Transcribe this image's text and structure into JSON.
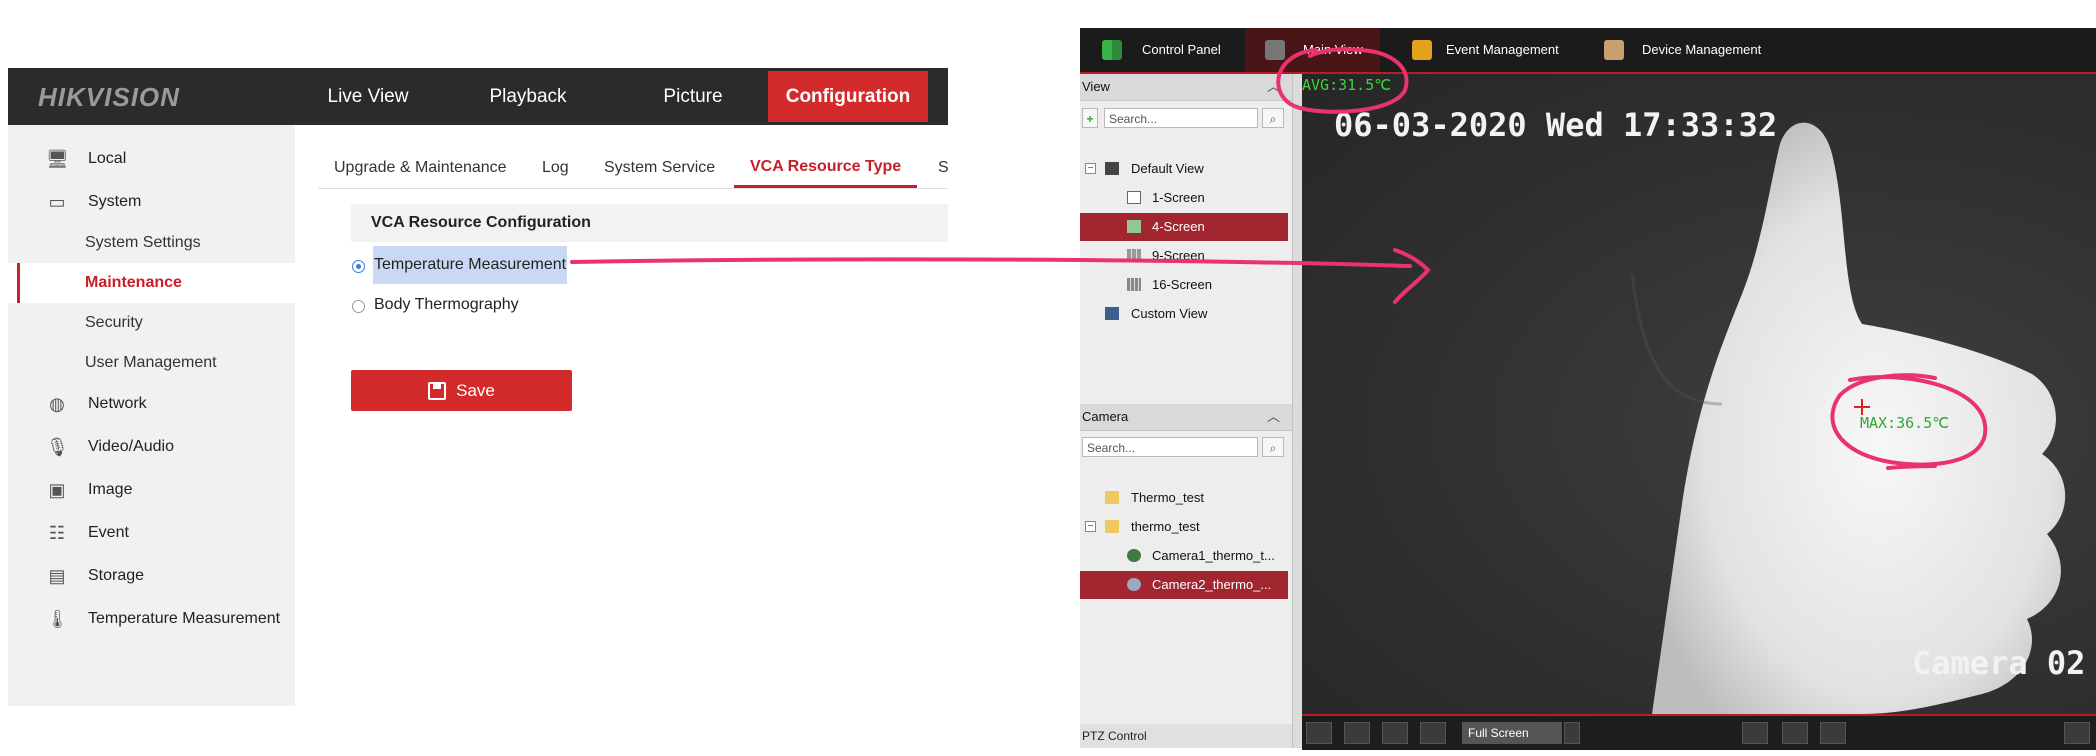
{
  "hikvision": {
    "logo_a": "HIK",
    "logo_b": "VISION",
    "nav": [
      "Live View",
      "Playback",
      "Picture",
      "Configuration"
    ],
    "sidebar": {
      "local": "Local",
      "system": "System",
      "system_settings": "System Settings",
      "maintenance": "Maintenance",
      "security": "Security",
      "user_management": "User Management",
      "network": "Network",
      "video_audio": "Video/Audio",
      "image": "Image",
      "event": "Event",
      "storage": "Storage",
      "temperature_measurement": "Temperature Measurement"
    },
    "tabs": [
      "Upgrade & Maintenance",
      "Log",
      "System Service",
      "VCA Resource Type",
      "S"
    ],
    "section_title": "VCA Resource Configuration",
    "options": [
      "Temperature Measurement",
      "Body Thermography"
    ],
    "selected_option": "Temperature Measurement",
    "save_label": "Save"
  },
  "ivms": {
    "tabs": [
      "Control Panel",
      "Main View",
      "Event Management",
      "Device Management"
    ],
    "view_panel": {
      "title": "View",
      "search_placeholder": "Search...",
      "items": [
        "Default View",
        "1-Screen",
        "4-Screen",
        "9-Screen",
        "16-Screen",
        "Custom View"
      ],
      "selected": "4-Screen"
    },
    "camera_panel": {
      "title": "Camera",
      "search_placeholder": "Search...",
      "items": [
        "Thermo_test",
        "thermo_test",
        "Camera1_thermo_t...",
        "Camera2_thermo_..."
      ],
      "selected": "Camera2_thermo_..."
    },
    "ptz_label": "PTZ Control",
    "video": {
      "timestamp": "06-03-2020 Wed 17:33:32",
      "avg": "AVG:31.5℃",
      "max": "MAX:36.5℃",
      "camera_label": "Camera 02"
    },
    "full_screen_label": "Full Screen"
  },
  "colors": {
    "hik_red": "#d32b2b",
    "annotation_pink": "#e8336c",
    "osd_green": "#39d63b",
    "ivms_selection": "#a12630"
  }
}
